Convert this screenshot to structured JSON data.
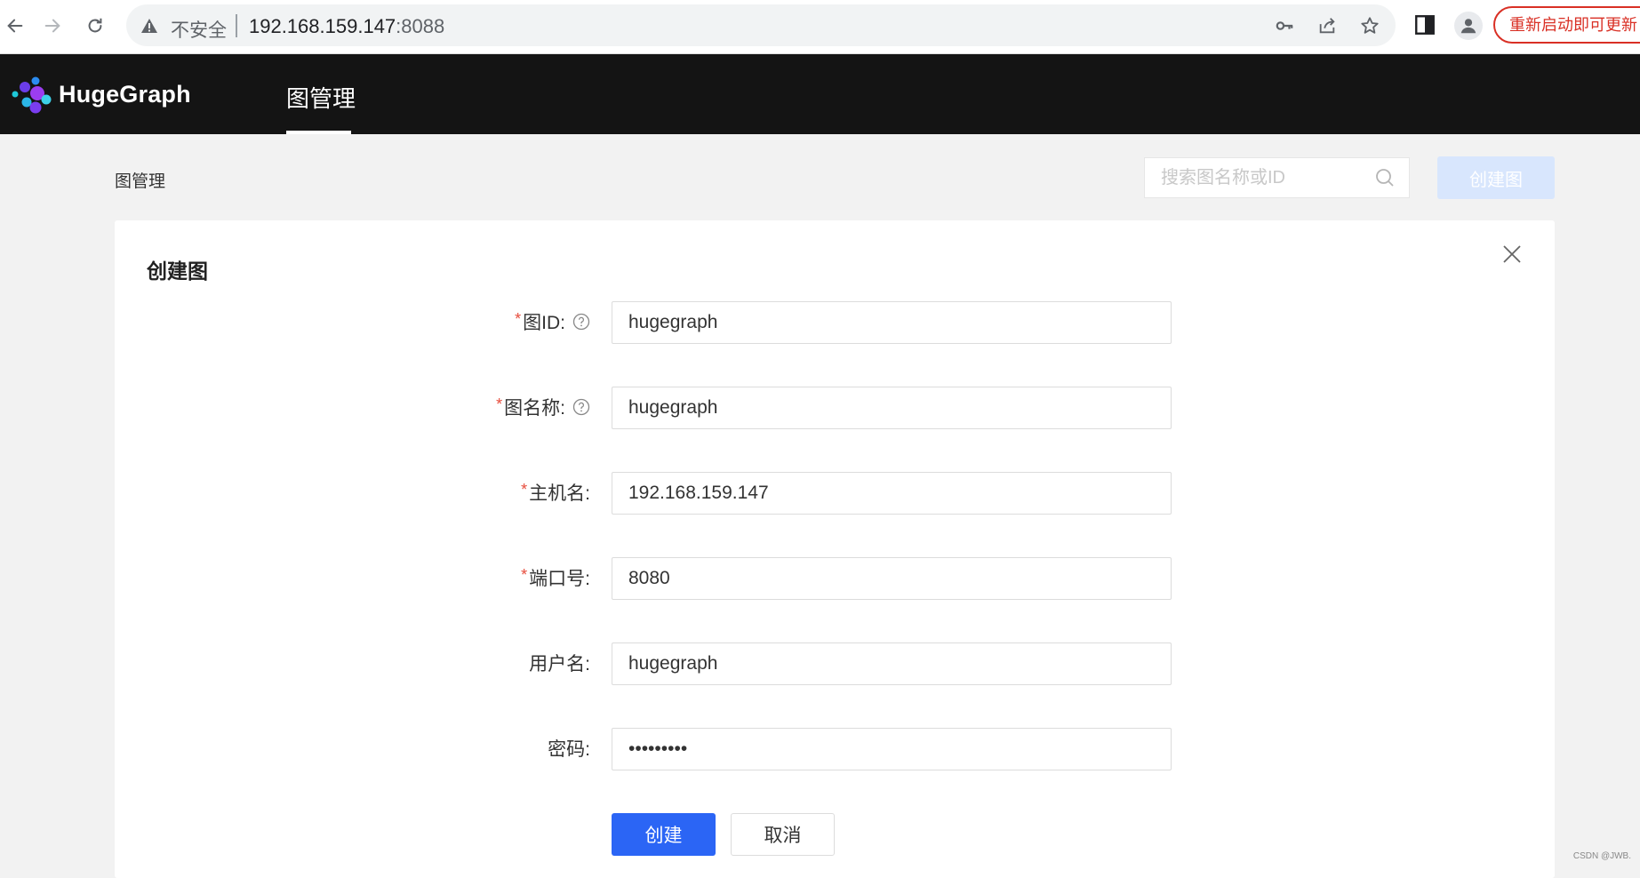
{
  "browser": {
    "insecure_label": "不安全",
    "host": "192.168.159.147",
    "port": ":8088",
    "update_label": "重新启动即可更新"
  },
  "header": {
    "brand": "HugeGraph",
    "nav_item": "图管理"
  },
  "toolbar": {
    "breadcrumb": "图管理",
    "search_placeholder": "搜索图名称或ID",
    "create_button": "创建图"
  },
  "dialog": {
    "title": "创建图",
    "fields": [
      {
        "label": "图ID:",
        "required": true,
        "help": true,
        "value": "hugegraph"
      },
      {
        "label": "图名称:",
        "required": true,
        "help": true,
        "value": "hugegraph"
      },
      {
        "label": "主机名:",
        "required": true,
        "help": false,
        "value": "192.168.159.147"
      },
      {
        "label": "端口号:",
        "required": true,
        "help": false,
        "value": "8080"
      },
      {
        "label": "用户名:",
        "required": false,
        "help": false,
        "value": "hugegraph"
      },
      {
        "label": "密码:",
        "required": false,
        "help": false,
        "value": "•••••••••"
      }
    ],
    "submit_label": "创建",
    "cancel_label": "取消"
  },
  "colors": {
    "header_bg": "#141414",
    "primary": "#2b65f5",
    "primary_disabled": "#d8e6fd",
    "required": "#e74c3c"
  },
  "watermark": "CSDN @JWB."
}
